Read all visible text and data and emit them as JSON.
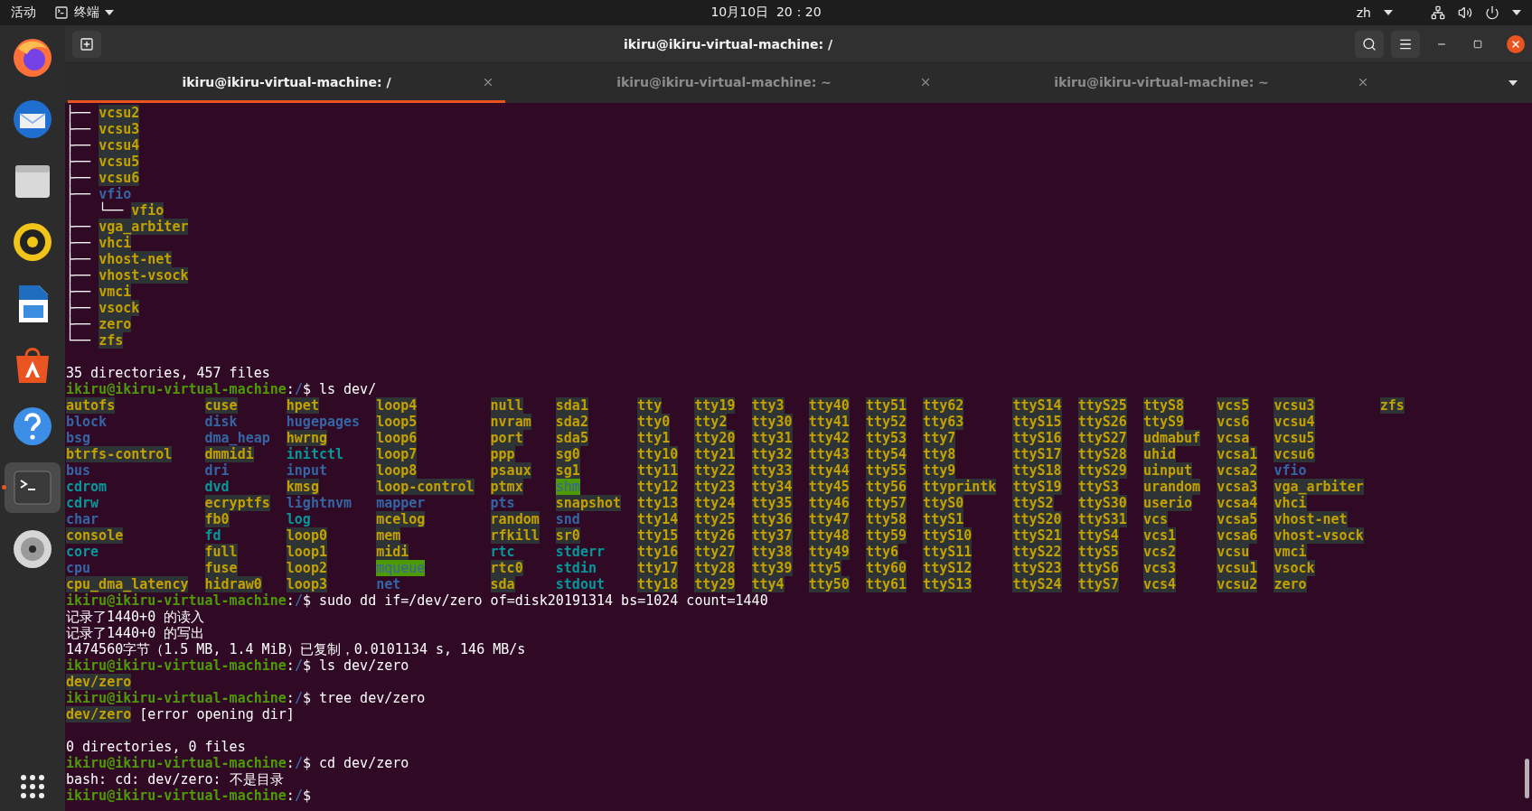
{
  "top_bar": {
    "activities": "活动",
    "app_menu": "终端",
    "clock": "10月10日  20：20",
    "input_method": "zh"
  },
  "dock": {
    "apps": [
      {
        "kind": "browser",
        "selected": false
      },
      {
        "kind": "mail",
        "selected": false
      },
      {
        "kind": "files",
        "selected": false
      },
      {
        "kind": "music",
        "selected": false
      },
      {
        "kind": "writer",
        "selected": false
      },
      {
        "kind": "store",
        "selected": false
      },
      {
        "kind": "help",
        "selected": false
      },
      {
        "kind": "terminal",
        "selected": true
      },
      {
        "kind": "disc",
        "selected": false
      }
    ]
  },
  "window": {
    "title": "ikiru@ikiru-virtual-machine: /",
    "tabs": [
      {
        "label": "ikiru@ikiru-virtual-machine: /",
        "selected": true
      },
      {
        "label": "ikiru@ikiru-virtual-machine: ~",
        "selected": false
      },
      {
        "label": "ikiru@ikiru-virtual-machine: ~",
        "selected": false
      }
    ]
  },
  "terminal": {
    "lines": [
      {
        "kind": "line",
        "segments": [
          {
            "text": "├── ",
            "kind": "tree"
          },
          {
            "text": "vcsu2",
            "kind": "device"
          }
        ]
      },
      {
        "kind": "line",
        "segments": [
          {
            "text": "├── ",
            "kind": "tree"
          },
          {
            "text": "vcsu3",
            "kind": "device"
          }
        ]
      },
      {
        "kind": "line",
        "segments": [
          {
            "text": "├── ",
            "kind": "tree"
          },
          {
            "text": "vcsu4",
            "kind": "device"
          }
        ]
      },
      {
        "kind": "line",
        "segments": [
          {
            "text": "├── ",
            "kind": "tree"
          },
          {
            "text": "vcsu5",
            "kind": "device"
          }
        ]
      },
      {
        "kind": "line",
        "segments": [
          {
            "text": "├── ",
            "kind": "tree"
          },
          {
            "text": "vcsu6",
            "kind": "device"
          }
        ]
      },
      {
        "kind": "line",
        "segments": [
          {
            "text": "├── ",
            "kind": "tree"
          },
          {
            "text": "vfio",
            "kind": "dir"
          }
        ]
      },
      {
        "kind": "line",
        "segments": [
          {
            "text": "│   └── ",
            "kind": "tree"
          },
          {
            "text": "vfio",
            "kind": "device"
          }
        ]
      },
      {
        "kind": "line",
        "segments": [
          {
            "text": "├── ",
            "kind": "tree"
          },
          {
            "text": "vga_arbiter",
            "kind": "device"
          }
        ]
      },
      {
        "kind": "line",
        "segments": [
          {
            "text": "├── ",
            "kind": "tree"
          },
          {
            "text": "vhci",
            "kind": "device"
          }
        ]
      },
      {
        "kind": "line",
        "segments": [
          {
            "text": "├── ",
            "kind": "tree"
          },
          {
            "text": "vhost-net",
            "kind": "device"
          }
        ]
      },
      {
        "kind": "line",
        "segments": [
          {
            "text": "├── ",
            "kind": "tree"
          },
          {
            "text": "vhost-vsock",
            "kind": "device"
          }
        ]
      },
      {
        "kind": "line",
        "segments": [
          {
            "text": "├── ",
            "kind": "tree"
          },
          {
            "text": "vmci",
            "kind": "device"
          }
        ]
      },
      {
        "kind": "line",
        "segments": [
          {
            "text": "├── ",
            "kind": "tree"
          },
          {
            "text": "vsock",
            "kind": "device"
          }
        ]
      },
      {
        "kind": "line",
        "segments": [
          {
            "text": "├── ",
            "kind": "tree"
          },
          {
            "text": "zero",
            "kind": "device"
          }
        ]
      },
      {
        "kind": "line",
        "segments": [
          {
            "text": "└── ",
            "kind": "tree"
          },
          {
            "text": "zfs",
            "kind": "device"
          }
        ]
      },
      {
        "kind": "blank"
      },
      {
        "kind": "line",
        "segments": [
          {
            "text": "35 directories, 457 files",
            "kind": "plain"
          }
        ]
      },
      {
        "kind": "line",
        "segments": [
          {
            "text": "ikiru@ikiru-virtual-machine",
            "kind": "user"
          },
          {
            "text": ":",
            "kind": "plain"
          },
          {
            "text": "/",
            "kind": "path"
          },
          {
            "text": "$ ls dev/",
            "kind": "plain"
          }
        ]
      },
      {
        "kind": "listing",
        "columns": [
          [
            {
              "name": "autofs",
              "kind": "device"
            },
            {
              "name": "block",
              "kind": "dir"
            },
            {
              "name": "bsg",
              "kind": "dir"
            },
            {
              "name": "btrfs-control",
              "kind": "device"
            },
            {
              "name": "bus",
              "kind": "dir"
            },
            {
              "name": "cdrom",
              "kind": "link"
            },
            {
              "name": "cdrw",
              "kind": "link"
            },
            {
              "name": "char",
              "kind": "dir"
            },
            {
              "name": "console",
              "kind": "device"
            },
            {
              "name": "core",
              "kind": "link"
            },
            {
              "name": "cpu",
              "kind": "dir"
            },
            {
              "name": "cpu_dma_latency",
              "kind": "device"
            }
          ],
          [
            {
              "name": "cuse",
              "kind": "device"
            },
            {
              "name": "disk",
              "kind": "dir"
            },
            {
              "name": "dma_heap",
              "kind": "dir"
            },
            {
              "name": "dmmidi",
              "kind": "device"
            },
            {
              "name": "dri",
              "kind": "dir"
            },
            {
              "name": "dvd",
              "kind": "link"
            },
            {
              "name": "ecryptfs",
              "kind": "device"
            },
            {
              "name": "fb0",
              "kind": "device"
            },
            {
              "name": "fd",
              "kind": "link"
            },
            {
              "name": "full",
              "kind": "device"
            },
            {
              "name": "fuse",
              "kind": "device"
            },
            {
              "name": "hidraw0",
              "kind": "device"
            }
          ],
          [
            {
              "name": "hpet",
              "kind": "device"
            },
            {
              "name": "hugepages",
              "kind": "dir"
            },
            {
              "name": "hwrng",
              "kind": "device"
            },
            {
              "name": "initctl",
              "kind": "link"
            },
            {
              "name": "input",
              "kind": "dir"
            },
            {
              "name": "kmsg",
              "kind": "device"
            },
            {
              "name": "lightnvm",
              "kind": "dir"
            },
            {
              "name": "log",
              "kind": "link"
            },
            {
              "name": "loop0",
              "kind": "device"
            },
            {
              "name": "loop1",
              "kind": "device"
            },
            {
              "name": "loop2",
              "kind": "device"
            },
            {
              "name": "loop3",
              "kind": "device"
            }
          ],
          [
            {
              "name": "loop4",
              "kind": "device"
            },
            {
              "name": "loop5",
              "kind": "device"
            },
            {
              "name": "loop6",
              "kind": "device"
            },
            {
              "name": "loop7",
              "kind": "device"
            },
            {
              "name": "loop8",
              "kind": "device"
            },
            {
              "name": "loop-control",
              "kind": "device"
            },
            {
              "name": "mapper",
              "kind": "dir"
            },
            {
              "name": "mcelog",
              "kind": "device"
            },
            {
              "name": "mem",
              "kind": "device"
            },
            {
              "name": "midi",
              "kind": "device"
            },
            {
              "name": "mqueue",
              "kind": "sticky"
            },
            {
              "name": "net",
              "kind": "dir"
            }
          ],
          [
            {
              "name": "null",
              "kind": "device"
            },
            {
              "name": "nvram",
              "kind": "device"
            },
            {
              "name": "port",
              "kind": "device"
            },
            {
              "name": "ppp",
              "kind": "device"
            },
            {
              "name": "psaux",
              "kind": "device"
            },
            {
              "name": "ptmx",
              "kind": "device"
            },
            {
              "name": "pts",
              "kind": "dir"
            },
            {
              "name": "random",
              "kind": "device"
            },
            {
              "name": "rfkill",
              "kind": "device"
            },
            {
              "name": "rtc",
              "kind": "link"
            },
            {
              "name": "rtc0",
              "kind": "device"
            },
            {
              "name": "sda",
              "kind": "device"
            }
          ],
          [
            {
              "name": "sda1",
              "kind": "device"
            },
            {
              "name": "sda2",
              "kind": "device"
            },
            {
              "name": "sda5",
              "kind": "device"
            },
            {
              "name": "sg0",
              "kind": "device"
            },
            {
              "name": "sg1",
              "kind": "device"
            },
            {
              "name": "shm",
              "kind": "sticky"
            },
            {
              "name": "snapshot",
              "kind": "device"
            },
            {
              "name": "snd",
              "kind": "dir"
            },
            {
              "name": "sr0",
              "kind": "device"
            },
            {
              "name": "stderr",
              "kind": "link"
            },
            {
              "name": "stdin",
              "kind": "link"
            },
            {
              "name": "stdout",
              "kind": "link"
            }
          ],
          [
            {
              "name": "tty",
              "kind": "device"
            },
            {
              "name": "tty0",
              "kind": "device"
            },
            {
              "name": "tty1",
              "kind": "device"
            },
            {
              "name": "tty10",
              "kind": "device"
            },
            {
              "name": "tty11",
              "kind": "device"
            },
            {
              "name": "tty12",
              "kind": "device"
            },
            {
              "name": "tty13",
              "kind": "device"
            },
            {
              "name": "tty14",
              "kind": "device"
            },
            {
              "name": "tty15",
              "kind": "device"
            },
            {
              "name": "tty16",
              "kind": "device"
            },
            {
              "name": "tty17",
              "kind": "device"
            },
            {
              "name": "tty18",
              "kind": "device"
            }
          ],
          [
            {
              "name": "tty19",
              "kind": "device"
            },
            {
              "name": "tty2",
              "kind": "device"
            },
            {
              "name": "tty20",
              "kind": "device"
            },
            {
              "name": "tty21",
              "kind": "device"
            },
            {
              "name": "tty22",
              "kind": "device"
            },
            {
              "name": "tty23",
              "kind": "device"
            },
            {
              "name": "tty24",
              "kind": "device"
            },
            {
              "name": "tty25",
              "kind": "device"
            },
            {
              "name": "tty26",
              "kind": "device"
            },
            {
              "name": "tty27",
              "kind": "device"
            },
            {
              "name": "tty28",
              "kind": "device"
            },
            {
              "name": "tty29",
              "kind": "device"
            }
          ],
          [
            {
              "name": "tty3",
              "kind": "device"
            },
            {
              "name": "tty30",
              "kind": "device"
            },
            {
              "name": "tty31",
              "kind": "device"
            },
            {
              "name": "tty32",
              "kind": "device"
            },
            {
              "name": "tty33",
              "kind": "device"
            },
            {
              "name": "tty34",
              "kind": "device"
            },
            {
              "name": "tty35",
              "kind": "device"
            },
            {
              "name": "tty36",
              "kind": "device"
            },
            {
              "name": "tty37",
              "kind": "device"
            },
            {
              "name": "tty38",
              "kind": "device"
            },
            {
              "name": "tty39",
              "kind": "device"
            },
            {
              "name": "tty4",
              "kind": "device"
            }
          ],
          [
            {
              "name": "tty40",
              "kind": "device"
            },
            {
              "name": "tty41",
              "kind": "device"
            },
            {
              "name": "tty42",
              "kind": "device"
            },
            {
              "name": "tty43",
              "kind": "device"
            },
            {
              "name": "tty44",
              "kind": "device"
            },
            {
              "name": "tty45",
              "kind": "device"
            },
            {
              "name": "tty46",
              "kind": "device"
            },
            {
              "name": "tty47",
              "kind": "device"
            },
            {
              "name": "tty48",
              "kind": "device"
            },
            {
              "name": "tty49",
              "kind": "device"
            },
            {
              "name": "tty5",
              "kind": "device"
            },
            {
              "name": "tty50",
              "kind": "device"
            }
          ],
          [
            {
              "name": "tty51",
              "kind": "device"
            },
            {
              "name": "tty52",
              "kind": "device"
            },
            {
              "name": "tty53",
              "kind": "device"
            },
            {
              "name": "tty54",
              "kind": "device"
            },
            {
              "name": "tty55",
              "kind": "device"
            },
            {
              "name": "tty56",
              "kind": "device"
            },
            {
              "name": "tty57",
              "kind": "device"
            },
            {
              "name": "tty58",
              "kind": "device"
            },
            {
              "name": "tty59",
              "kind": "device"
            },
            {
              "name": "tty6",
              "kind": "device"
            },
            {
              "name": "tty60",
              "kind": "device"
            },
            {
              "name": "tty61",
              "kind": "device"
            }
          ],
          [
            {
              "name": "tty62",
              "kind": "device"
            },
            {
              "name": "tty63",
              "kind": "device"
            },
            {
              "name": "tty7",
              "kind": "device"
            },
            {
              "name": "tty8",
              "kind": "device"
            },
            {
              "name": "tty9",
              "kind": "device"
            },
            {
              "name": "ttyprintk",
              "kind": "device"
            },
            {
              "name": "ttyS0",
              "kind": "device"
            },
            {
              "name": "ttyS1",
              "kind": "device"
            },
            {
              "name": "ttyS10",
              "kind": "device"
            },
            {
              "name": "ttyS11",
              "kind": "device"
            },
            {
              "name": "ttyS12",
              "kind": "device"
            },
            {
              "name": "ttyS13",
              "kind": "device"
            }
          ],
          [
            {
              "name": "ttyS14",
              "kind": "device"
            },
            {
              "name": "ttyS15",
              "kind": "device"
            },
            {
              "name": "ttyS16",
              "kind": "device"
            },
            {
              "name": "ttyS17",
              "kind": "device"
            },
            {
              "name": "ttyS18",
              "kind": "device"
            },
            {
              "name": "ttyS19",
              "kind": "device"
            },
            {
              "name": "ttyS2",
              "kind": "device"
            },
            {
              "name": "ttyS20",
              "kind": "device"
            },
            {
              "name": "ttyS21",
              "kind": "device"
            },
            {
              "name": "ttyS22",
              "kind": "device"
            },
            {
              "name": "ttyS23",
              "kind": "device"
            },
            {
              "name": "ttyS24",
              "kind": "device"
            }
          ],
          [
            {
              "name": "ttyS25",
              "kind": "device"
            },
            {
              "name": "ttyS26",
              "kind": "device"
            },
            {
              "name": "ttyS27",
              "kind": "device"
            },
            {
              "name": "ttyS28",
              "kind": "device"
            },
            {
              "name": "ttyS29",
              "kind": "device"
            },
            {
              "name": "ttyS3",
              "kind": "device"
            },
            {
              "name": "ttyS30",
              "kind": "device"
            },
            {
              "name": "ttyS31",
              "kind": "device"
            },
            {
              "name": "ttyS4",
              "kind": "device"
            },
            {
              "name": "ttyS5",
              "kind": "device"
            },
            {
              "name": "ttyS6",
              "kind": "device"
            },
            {
              "name": "ttyS7",
              "kind": "device"
            }
          ],
          [
            {
              "name": "ttyS8",
              "kind": "device"
            },
            {
              "name": "ttyS9",
              "kind": "device"
            },
            {
              "name": "udmabuf",
              "kind": "device"
            },
            {
              "name": "uhid",
              "kind": "device"
            },
            {
              "name": "uinput",
              "kind": "device"
            },
            {
              "name": "urandom",
              "kind": "device"
            },
            {
              "name": "userio",
              "kind": "device"
            },
            {
              "name": "vcs",
              "kind": "device"
            },
            {
              "name": "vcs1",
              "kind": "device"
            },
            {
              "name": "vcs2",
              "kind": "device"
            },
            {
              "name": "vcs3",
              "kind": "device"
            },
            {
              "name": "vcs4",
              "kind": "device"
            }
          ],
          [
            {
              "name": "vcs5",
              "kind": "device"
            },
            {
              "name": "vcs6",
              "kind": "device"
            },
            {
              "name": "vcsa",
              "kind": "device"
            },
            {
              "name": "vcsa1",
              "kind": "device"
            },
            {
              "name": "vcsa2",
              "kind": "device"
            },
            {
              "name": "vcsa3",
              "kind": "device"
            },
            {
              "name": "vcsa4",
              "kind": "device"
            },
            {
              "name": "vcsa5",
              "kind": "device"
            },
            {
              "name": "vcsa6",
              "kind": "device"
            },
            {
              "name": "vcsu",
              "kind": "device"
            },
            {
              "name": "vcsu1",
              "kind": "device"
            },
            {
              "name": "vcsu2",
              "kind": "device"
            }
          ],
          [
            {
              "name": "vcsu3",
              "kind": "device"
            },
            {
              "name": "vcsu4",
              "kind": "device"
            },
            {
              "name": "vcsu5",
              "kind": "device"
            },
            {
              "name": "vcsu6",
              "kind": "device"
            },
            {
              "name": "vfio",
              "kind": "dir"
            },
            {
              "name": "vga_arbiter",
              "kind": "device"
            },
            {
              "name": "vhci",
              "kind": "device"
            },
            {
              "name": "vhost-net",
              "kind": "device"
            },
            {
              "name": "vhost-vsock",
              "kind": "device"
            },
            {
              "name": "vmci",
              "kind": "device"
            },
            {
              "name": "vsock",
              "kind": "device"
            },
            {
              "name": "zero",
              "kind": "device"
            }
          ],
          [
            {
              "name": "zfs",
              "kind": "device"
            }
          ]
        ]
      },
      {
        "kind": "line",
        "segments": [
          {
            "text": "ikiru@ikiru-virtual-machine",
            "kind": "user"
          },
          {
            "text": ":",
            "kind": "plain"
          },
          {
            "text": "/",
            "kind": "path"
          },
          {
            "text": "$ sudo dd if=/dev/zero of=disk20191314 bs=1024 count=1440",
            "kind": "plain"
          }
        ]
      },
      {
        "kind": "line",
        "segments": [
          {
            "text": "记录了1440+0 的读入",
            "kind": "plain"
          }
        ]
      },
      {
        "kind": "line",
        "segments": [
          {
            "text": "记录了1440+0 的写出",
            "kind": "plain"
          }
        ]
      },
      {
        "kind": "line",
        "segments": [
          {
            "text": "1474560字节（1.5 MB, 1.4 MiB）已复制，0.0101134 s, 146 MB/s",
            "kind": "plain"
          }
        ]
      },
      {
        "kind": "line",
        "segments": [
          {
            "text": "ikiru@ikiru-virtual-machine",
            "kind": "user"
          },
          {
            "text": ":",
            "kind": "plain"
          },
          {
            "text": "/",
            "kind": "path"
          },
          {
            "text": "$ ls dev/zero",
            "kind": "plain"
          }
        ]
      },
      {
        "kind": "line",
        "segments": [
          {
            "text": "dev/zero",
            "kind": "device"
          }
        ]
      },
      {
        "kind": "line",
        "segments": [
          {
            "text": "ikiru@ikiru-virtual-machine",
            "kind": "user"
          },
          {
            "text": ":",
            "kind": "plain"
          },
          {
            "text": "/",
            "kind": "path"
          },
          {
            "text": "$ tree dev/zero",
            "kind": "plain"
          }
        ]
      },
      {
        "kind": "line",
        "segments": [
          {
            "text": "dev/zero",
            "kind": "device"
          },
          {
            "text": " [error opening dir]",
            "kind": "plain"
          }
        ]
      },
      {
        "kind": "blank"
      },
      {
        "kind": "line",
        "segments": [
          {
            "text": "0 directories, 0 files",
            "kind": "plain"
          }
        ]
      },
      {
        "kind": "line",
        "segments": [
          {
            "text": "ikiru@ikiru-virtual-machine",
            "kind": "user"
          },
          {
            "text": ":",
            "kind": "plain"
          },
          {
            "text": "/",
            "kind": "path"
          },
          {
            "text": "$ cd dev/zero",
            "kind": "plain"
          }
        ]
      },
      {
        "kind": "line",
        "segments": [
          {
            "text": "bash: cd: dev/zero: 不是目录",
            "kind": "plain"
          }
        ]
      },
      {
        "kind": "line",
        "segments": [
          {
            "text": "ikiru@ikiru-virtual-machine",
            "kind": "user"
          },
          {
            "text": ":",
            "kind": "plain"
          },
          {
            "text": "/",
            "kind": "path"
          },
          {
            "text": "$",
            "kind": "plain"
          }
        ]
      }
    ]
  }
}
